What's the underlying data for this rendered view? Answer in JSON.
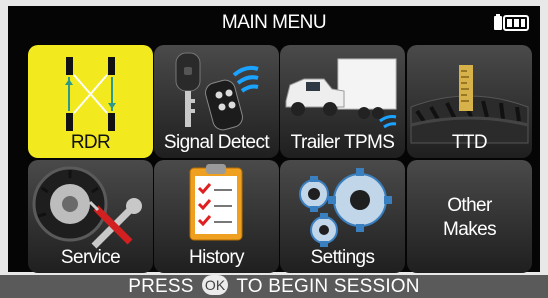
{
  "header": {
    "title": "MAIN MENU",
    "battery_icon": "battery-icon"
  },
  "tiles": [
    {
      "label": "RDR",
      "icon": "wheel-rotation-icon",
      "selected": true
    },
    {
      "label": "Signal Detect",
      "icon": "key-fob-signal-icon"
    },
    {
      "label": "Trailer TPMS",
      "icon": "truck-trailer-icon"
    },
    {
      "label": "TTD",
      "icon": "tread-depth-icon"
    },
    {
      "label": "Service",
      "icon": "tire-tools-icon"
    },
    {
      "label": "History",
      "icon": "clipboard-checklist-icon"
    },
    {
      "label": "Settings",
      "icon": "gears-icon"
    },
    {
      "label_line1": "Other",
      "label_line2": "Makes",
      "icon": ""
    }
  ],
  "footer": {
    "before": "PRESS",
    "ok_key": "OK",
    "after": "TO BEGIN SESSION"
  },
  "colors": {
    "selected": "#f2ea1e",
    "tile": "#2e2e2e",
    "background": "#050505"
  }
}
